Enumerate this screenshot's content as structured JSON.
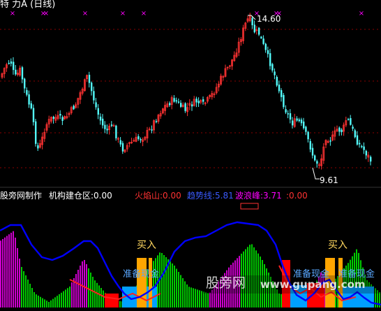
{
  "header": {
    "title": "特 力A (日线)",
    "price_high_label": "14.60",
    "price_low_label": "9.61"
  },
  "indicator": {
    "source_label": "股旁网制作",
    "jigou_label": "机构建仓区:",
    "jigou_value": "0.00",
    "huoyanshan_label": "火焰山:",
    "huoyanshan_value": "0.00",
    "qushixian_label": "趋势线:",
    "qushixian_value": "5.81",
    "bolangfeng_label": "波浪峰:",
    "bolangfeng_value": "3.71",
    "extra_value": ":0.00",
    "buy_label_1": "买入",
    "buy_label_2": "买入",
    "prepare_cash_1": "准备现金",
    "prepare_cash_2": "准备现金",
    "prepare_cash_3": "准备现金"
  },
  "watermark": {
    "text_cn": "股旁网",
    "text_url": "www.gupang.com"
  },
  "colors": {
    "background": "#000000",
    "up": "#ff3232",
    "down": "#54fcfc",
    "marker": "#ff00ff",
    "trend_line": "#0000ff",
    "bars_green": "#00ff00",
    "bars_magenta": "#ff00ff",
    "buy_bar": "#ffa500",
    "fill_blue": "#00a0ff",
    "fill_red": "#ff0000",
    "text_yellow": "#ffd75f",
    "grid_red": "#8b0000"
  }
}
